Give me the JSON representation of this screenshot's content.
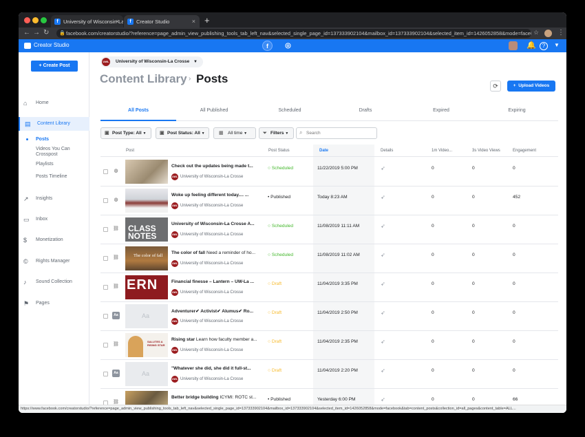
{
  "browser": {
    "tabs": [
      {
        "label": "University of Wisconsin-La Cro"
      },
      {
        "label": "Creator Studio"
      }
    ],
    "url": "facebook.com/creatorstudio/?reference=page_admin_view_publishing_tools_tab_left_nav&selected_single_page_id=137333902104&mailbox_id=137333902104&selected_item_id=1426052858&mode=facebook&ta...",
    "status_url": "https://www.facebook.com/creatorstudio/?reference=page_admin_view_publishing_tools_tab_left_nav&selected_single_page_id=137333902104&mailbox_id=137333902104&selected_item_id=1426052858&mode=facebook&tab=content_posts&collection_id=all_pages&content_table=ALL..."
  },
  "header": {
    "brand": "Creator Studio"
  },
  "sidebar": {
    "create_label": "Create Post",
    "items": [
      {
        "label": "Home",
        "icon": "home-icon"
      },
      {
        "label": "Content Library",
        "icon": "content-library-icon"
      },
      {
        "label": "Insights",
        "icon": "insights-icon"
      },
      {
        "label": "Inbox",
        "icon": "inbox-icon"
      },
      {
        "label": "Monetization",
        "icon": "monetization-icon"
      },
      {
        "label": "Rights Manager",
        "icon": "rights-manager-icon"
      },
      {
        "label": "Sound Collection",
        "icon": "sound-collection-icon"
      },
      {
        "label": "Pages",
        "icon": "pages-icon"
      }
    ],
    "subitems": [
      "Posts",
      "Videos You Can Crosspost",
      "Playlists",
      "Posts Timeline"
    ]
  },
  "main": {
    "page_name": "University of Wisconsin-La Crosse",
    "breadcrumb_parent": "Content Library",
    "breadcrumb_current": "Posts",
    "upload_label": "Upload Videos",
    "tabs": [
      "All Posts",
      "All Published",
      "Scheduled",
      "Drafts",
      "Expired",
      "Expiring"
    ],
    "filters": {
      "post_type": "Post Type:",
      "post_type_value": "All",
      "post_status": "Post Status:",
      "post_status_value": "All",
      "time": "All time",
      "filters_label": "Filters",
      "search_placeholder": "Search"
    },
    "columns": [
      "Post",
      "Post Status",
      "Date",
      "Details",
      "1m Video...",
      "3s Video Views",
      "Engagement"
    ],
    "author": "University of Wisconsin-La Crosse",
    "rows": [
      {
        "title": "Check out the updates being made t...",
        "status": "Scheduled",
        "date": "11/22/2019 5:00 PM",
        "v1m": "0",
        "v3s": "0",
        "eng": "0"
      },
      {
        "title": "Woke up feeling different today.... ...",
        "status": "Published",
        "date": "Today 8:23 AM",
        "v1m": "0",
        "v3s": "0",
        "eng": "452"
      },
      {
        "title": "University of Wisconsin-La Crosse A...",
        "status": "Scheduled",
        "date": "11/08/2019 11:11 AM",
        "v1m": "0",
        "v3s": "0",
        "eng": "0"
      },
      {
        "title": "The color of fall",
        "title_rest": "Need a reminder of ho...",
        "status": "Scheduled",
        "date": "11/08/2019 11:02 AM",
        "v1m": "0",
        "v3s": "0",
        "eng": "0"
      },
      {
        "title": "Financial finesse – Lantern – UW-La ...",
        "status": "Draft",
        "date": "11/04/2019 3:35 PM",
        "v1m": "0",
        "v3s": "0",
        "eng": "0"
      },
      {
        "title": "Adventurer✔ Activist✔ Alumus✔ Ro...",
        "status": "Draft",
        "date": "11/04/2019 2:50 PM",
        "v1m": "0",
        "v3s": "0",
        "eng": "0"
      },
      {
        "title": "Rising star",
        "title_rest": "Learn how faculty member a...",
        "status": "Draft",
        "date": "11/04/2019 2:35 PM",
        "v1m": "0",
        "v3s": "0",
        "eng": "0"
      },
      {
        "title": "\"Whatever she did, she did it full-st...",
        "status": "Draft",
        "date": "11/04/2019 2:20 PM",
        "v1m": "0",
        "v3s": "0",
        "eng": "0"
      },
      {
        "title": "Better bridge building",
        "title_rest": "ICYMI: ROTC st...",
        "status": "Published",
        "date": "Yesterday 6:00 PM",
        "v1m": "0",
        "v3s": "0",
        "eng": "66"
      }
    ],
    "thumb_texts": {
      "class_notes": "CLASS NOTES",
      "color_fall": "The color of fall",
      "ern": "ERN",
      "aa": "Aa",
      "rising": "SALUTES A RISING STAR"
    }
  },
  "colors": {
    "brand": "#1877f2",
    "scheduled": "#42b72a",
    "draft": "#f7b928",
    "uwl": "#9b1c1f"
  }
}
